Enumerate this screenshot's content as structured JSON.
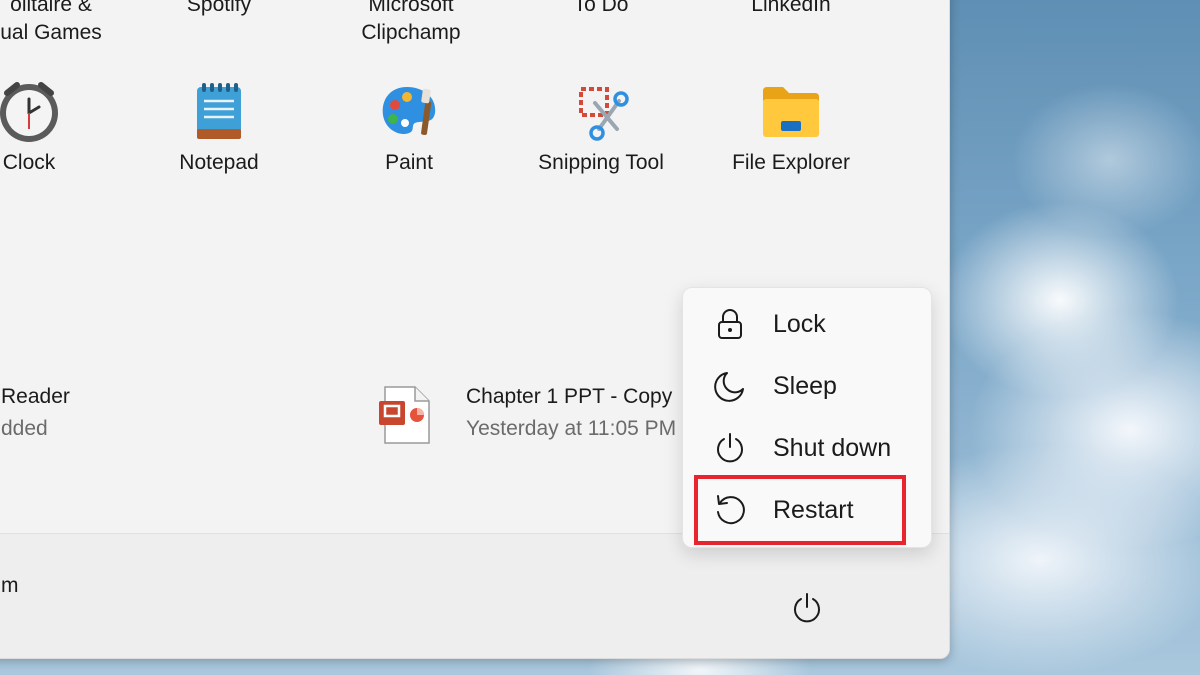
{
  "start_menu": {
    "top_row": [
      {
        "label_line1": "olitaire &",
        "label_line2": "ual Games"
      },
      {
        "label_line1": "Spotify",
        "label_line2": ""
      },
      {
        "label_line1": "Microsoft",
        "label_line2": "Clipchamp"
      },
      {
        "label_line1": "To Do",
        "label_line2": ""
      },
      {
        "label_line1": "LinkedIn",
        "label_line2": ""
      }
    ],
    "pinned_apps": [
      {
        "label": "Clock",
        "icon": "clock-icon"
      },
      {
        "label": "Notepad",
        "icon": "notepad-icon"
      },
      {
        "label": "Paint",
        "icon": "paint-icon"
      },
      {
        "label": "Snipping Tool",
        "icon": "snipping-tool-icon"
      },
      {
        "label": "File Explorer",
        "icon": "folder-icon"
      }
    ],
    "recommended": [
      {
        "title": "Reader",
        "subtitle": "dded"
      },
      {
        "title": "Chapter 1 PPT - Copy",
        "subtitle": "Yesterday at 11:05 PM",
        "icon": "powerpoint-file-icon"
      }
    ],
    "footer": {
      "user_name": "m",
      "power_icon": "power-icon"
    }
  },
  "power_menu": {
    "items": [
      {
        "label": "Lock",
        "icon": "lock-icon"
      },
      {
        "label": "Sleep",
        "icon": "moon-icon"
      },
      {
        "label": "Shut down",
        "icon": "power-icon"
      },
      {
        "label": "Restart",
        "icon": "restart-icon"
      }
    ],
    "highlighted_item": "Restart",
    "highlight_color": "#e8242f"
  }
}
